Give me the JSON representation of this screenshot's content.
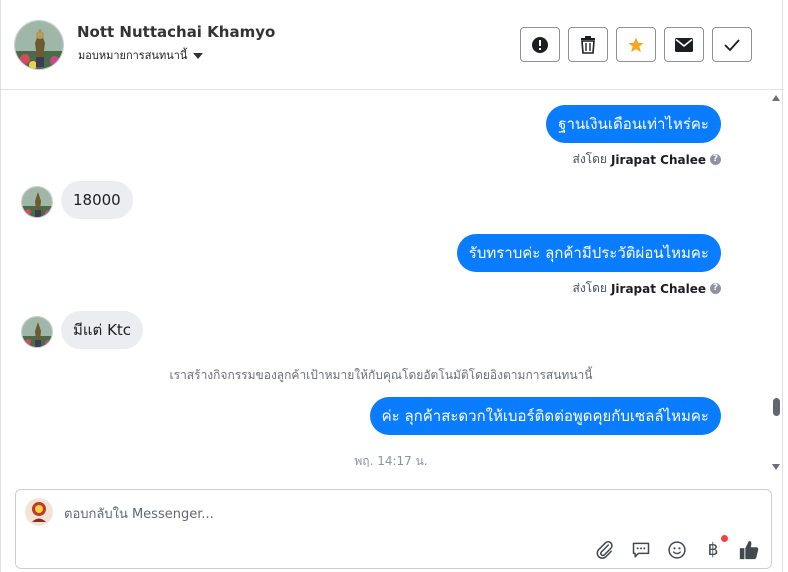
{
  "header": {
    "contact_name": "Nott Nuttachai Khamyo",
    "assign_label": "มอบหมายการสนทนานี้"
  },
  "toolbar": {
    "buttons": [
      {
        "icon": "alert-icon",
        "color": "#1c1e21"
      },
      {
        "icon": "trash-icon",
        "color": "#1c1e21"
      },
      {
        "icon": "star-icon",
        "color": "#f5a623"
      },
      {
        "icon": "envelope-icon",
        "color": "#1c1e21"
      },
      {
        "icon": "check-icon",
        "color": "#1c1e21"
      }
    ]
  },
  "messages": [
    {
      "direction": "out",
      "text": "ฐานเงินเดือนเท่าไหร่คะ",
      "sent_by_prefix": "ส่งโดย",
      "sent_by_name": "Jirapat Chalee"
    },
    {
      "direction": "in",
      "text": "18000"
    },
    {
      "direction": "out",
      "text": "รับทราบค่ะ ลุกค้ามีประวัติผ่อนไหมคะ",
      "sent_by_prefix": "ส่งโดย",
      "sent_by_name": "Jirapat Chalee"
    },
    {
      "direction": "in",
      "text": "มีแต่ Ktc"
    },
    {
      "direction": "system",
      "text": "เราสร้างกิจกรรมของลูกค้าเป้าหมายให้กับคุณโดยอัตโนมัติโดยอิงตามการสนทนานี้"
    },
    {
      "direction": "out",
      "text": "ค่ะ ลุกค้าสะดวกให้เบอร์ติดต่อพูดคุยกับเซลล์ไหมคะ"
    },
    {
      "direction": "time",
      "text": "พฤ. 14:17 น."
    }
  ],
  "composer": {
    "placeholder": "ตอบกลับใน Messenger...",
    "value": "",
    "icons": [
      "attachment-icon",
      "saved-reply-icon",
      "emoji-icon",
      "baht-payment-icon",
      "thumbs-up-icon"
    ]
  },
  "colors": {
    "outgoing_bubble": "#0a7cff",
    "incoming_bubble": "#ebedf0",
    "accent_star": "#f5a623",
    "notification_dot": "#fa3e3e"
  }
}
